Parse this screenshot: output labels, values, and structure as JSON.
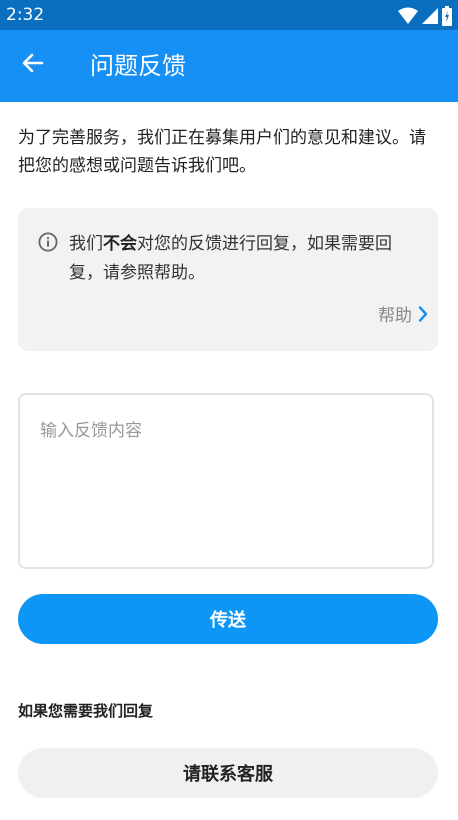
{
  "status_bar": {
    "time": "2:32",
    "icons": [
      "wifi-icon",
      "signal-icon",
      "battery-charging-icon"
    ]
  },
  "app_bar": {
    "back_icon": "arrow-back-icon",
    "title": "问题反馈",
    "background": "#1690f4"
  },
  "intro": {
    "text": "为了完善服务，我们正在募集用户们的意见和建议。请把您的感想或问题告诉我们吧。"
  },
  "notice": {
    "icon": "info-icon",
    "text_before": "我们",
    "text_bold": "不会",
    "text_after": "对您的反馈进行回复，如果需要回复，请参照帮助。",
    "help_label": "帮助",
    "help_icon": "chevron-right-icon"
  },
  "feedback": {
    "placeholder": "输入反馈内容",
    "value": ""
  },
  "send_button": {
    "label": "传送",
    "color": "#0d96f5"
  },
  "reply_section": {
    "heading": "如果您需要我们回复",
    "contact_button_label": "请联系客服"
  }
}
